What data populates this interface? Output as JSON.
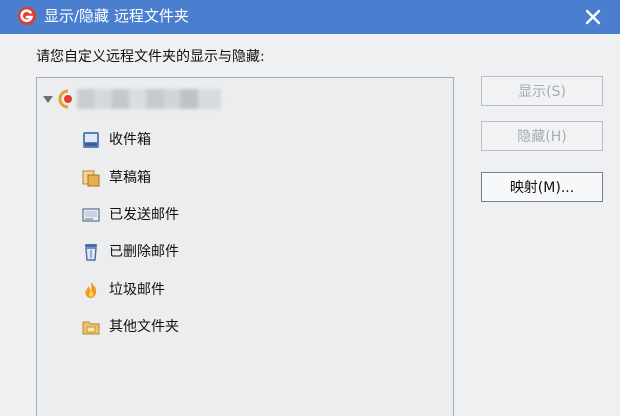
{
  "window": {
    "title": "显示/隐藏 远程文件夹",
    "close_glyph": "✕"
  },
  "prompt_text": "请您自定义远程文件夹的显示与隐藏:",
  "tree": {
    "account_label": "",
    "folders": [
      {
        "label": "收件箱",
        "icon": "inbox-icon"
      },
      {
        "label": "草稿箱",
        "icon": "drafts-icon"
      },
      {
        "label": "已发送邮件",
        "icon": "sent-mail-icon"
      },
      {
        "label": "已删除邮件",
        "icon": "trash-icon"
      },
      {
        "label": "垃圾邮件",
        "icon": "junk-flame-icon"
      },
      {
        "label": "其他文件夹",
        "icon": "other-folder-icon"
      }
    ]
  },
  "buttons": {
    "show": {
      "label": "显示(S)",
      "enabled": false
    },
    "hide": {
      "label": "隐藏(H)",
      "enabled": false
    },
    "map": {
      "label": "映射(M)...",
      "enabled": true
    }
  },
  "colors": {
    "titlebar": "#4a7fd0",
    "background": "#eef0f2",
    "tree_background": "#ebedef",
    "disabled_text": "#a8adb2"
  }
}
